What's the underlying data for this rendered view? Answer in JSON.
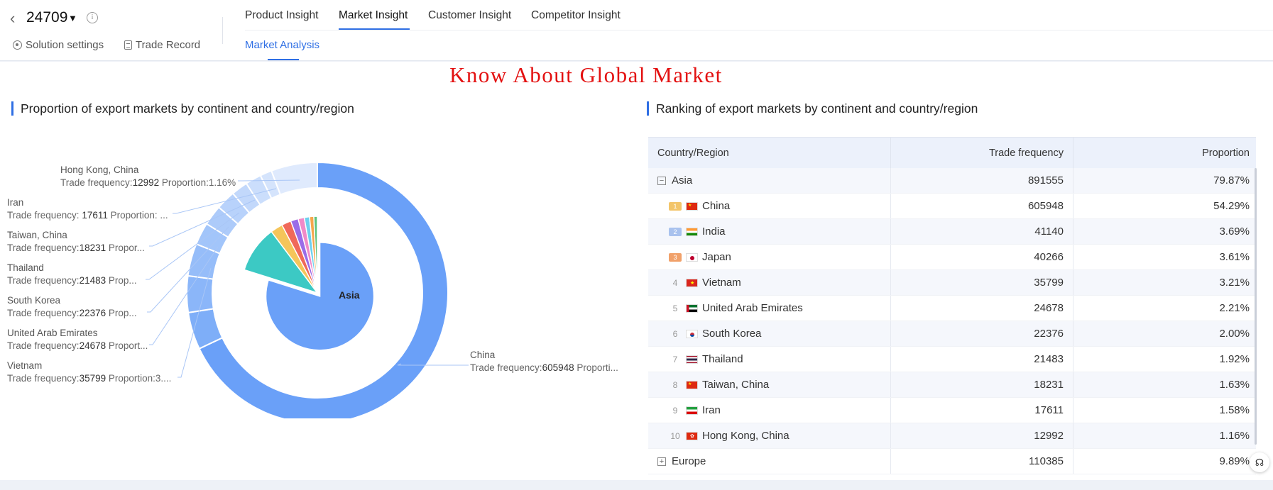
{
  "header": {
    "back_icon": "chevron-left-icon",
    "hs_code": "24709",
    "caret": "▼",
    "info": "i",
    "solution_settings": "Solution settings",
    "trade_record": "Trade Record",
    "tabs": [
      {
        "label": "Product Insight",
        "active": false
      },
      {
        "label": "Market Insight",
        "active": true
      },
      {
        "label": "Customer Insight",
        "active": false
      },
      {
        "label": "Competitor Insight",
        "active": false
      }
    ],
    "subtab": "Market Analysis"
  },
  "banner_title": "Know About Global Market",
  "left_section": {
    "title": "Proportion of export markets by continent and country/region",
    "inner_label": "Asia",
    "labels": [
      {
        "name": "Hong Kong, China",
        "freq_label": "Trade frequency:",
        "freq": "12992",
        "prop": "Proportion:1.16%"
      },
      {
        "name": "Iran",
        "freq_label": "Trade frequency:",
        "freq": " 17611",
        "prop": "Proportion: ..."
      },
      {
        "name": "Taiwan, China",
        "freq_label": "Trade frequency:",
        "freq": "18231",
        "prop": "Propor..."
      },
      {
        "name": "Thailand",
        "freq_label": "Trade frequency:",
        "freq": "21483",
        "prop": "Prop..."
      },
      {
        "name": "South Korea",
        "freq_label": "Trade frequency:",
        "freq": "22376",
        "prop": "Prop..."
      },
      {
        "name": "United Arab Emirates",
        "freq_label": "Trade frequency:",
        "freq": "24678",
        "prop": "Proport..."
      },
      {
        "name": "Vietnam",
        "freq_label": "Trade frequency:",
        "freq": "35799",
        "prop": "Proportion:3...."
      },
      {
        "name": "China",
        "freq_label": "Trade frequency:",
        "freq": "605948",
        "prop": "Proporti..."
      }
    ]
  },
  "right_section": {
    "title": "Ranking of export markets by continent and country/region",
    "columns": [
      "Country/Region",
      "Trade frequency",
      "Proportion"
    ],
    "rows": [
      {
        "type": "group",
        "icon": "−",
        "name": "Asia",
        "freq": "891555",
        "prop": "79.87%"
      },
      {
        "type": "item",
        "rank": "1",
        "flag": "cn",
        "name": "China",
        "freq": "605948",
        "prop": "54.29%"
      },
      {
        "type": "item",
        "rank": "2",
        "flag": "in",
        "name": "India",
        "freq": "41140",
        "prop": "3.69%"
      },
      {
        "type": "item",
        "rank": "3",
        "flag": "jp",
        "name": "Japan",
        "freq": "40266",
        "prop": "3.61%"
      },
      {
        "type": "item",
        "rank": "4",
        "flag": "vn",
        "name": "Vietnam",
        "freq": "35799",
        "prop": "3.21%"
      },
      {
        "type": "item",
        "rank": "5",
        "flag": "ae",
        "name": "United Arab Emirates",
        "freq": "24678",
        "prop": "2.21%"
      },
      {
        "type": "item",
        "rank": "6",
        "flag": "kr",
        "name": "South Korea",
        "freq": "22376",
        "prop": "2.00%"
      },
      {
        "type": "item",
        "rank": "7",
        "flag": "th",
        "name": "Thailand",
        "freq": "21483",
        "prop": "1.92%"
      },
      {
        "type": "item",
        "rank": "8",
        "flag": "cn",
        "name": "Taiwan, China",
        "freq": "18231",
        "prop": "1.63%"
      },
      {
        "type": "item",
        "rank": "9",
        "flag": "ir",
        "name": "Iran",
        "freq": "17611",
        "prop": "1.58%"
      },
      {
        "type": "item",
        "rank": "10",
        "flag": "hk",
        "name": "Hong Kong, China",
        "freq": "12992",
        "prop": "1.16%"
      },
      {
        "type": "group",
        "icon": "+",
        "name": "Europe",
        "freq": "110385",
        "prop": "9.89%"
      }
    ]
  },
  "chart_data": {
    "type": "pie",
    "title": "Proportion of export markets by continent and country/region",
    "inner_ring": {
      "slices": [
        {
          "name": "Asia",
          "value": 79.87,
          "color": "#6aa0f8"
        },
        {
          "name": "",
          "value": 9.89,
          "color": "#3cc9c4"
        },
        {
          "name": "",
          "value": 2.6,
          "color": "#f5c55a"
        },
        {
          "name": "",
          "value": 2.0,
          "color": "#f0695a"
        },
        {
          "name": "",
          "value": 1.6,
          "color": "#9a6ce8"
        },
        {
          "name": "",
          "value": 1.3,
          "color": "#f08ac8"
        },
        {
          "name": "",
          "value": 1.1,
          "color": "#6ed0ee"
        },
        {
          "name": "",
          "value": 0.9,
          "color": "#f6a64c"
        },
        {
          "name": "",
          "value": 0.74,
          "color": "#5fc27e"
        }
      ]
    },
    "outer_ring": {
      "slices": [
        {
          "name": "China",
          "value": 605948
        },
        {
          "name": "India",
          "value": 41140
        },
        {
          "name": "Japan",
          "value": 40266
        },
        {
          "name": "Vietnam",
          "value": 35799
        },
        {
          "name": "United Arab Emirates",
          "value": 24678
        },
        {
          "name": "South Korea",
          "value": 22376
        },
        {
          "name": "Thailand",
          "value": 21483
        },
        {
          "name": "Taiwan, China",
          "value": 18231
        },
        {
          "name": "Iran",
          "value": 17611
        },
        {
          "name": "Hong Kong, China",
          "value": 12992
        },
        {
          "name": "",
          "value": 51031
        }
      ]
    }
  }
}
